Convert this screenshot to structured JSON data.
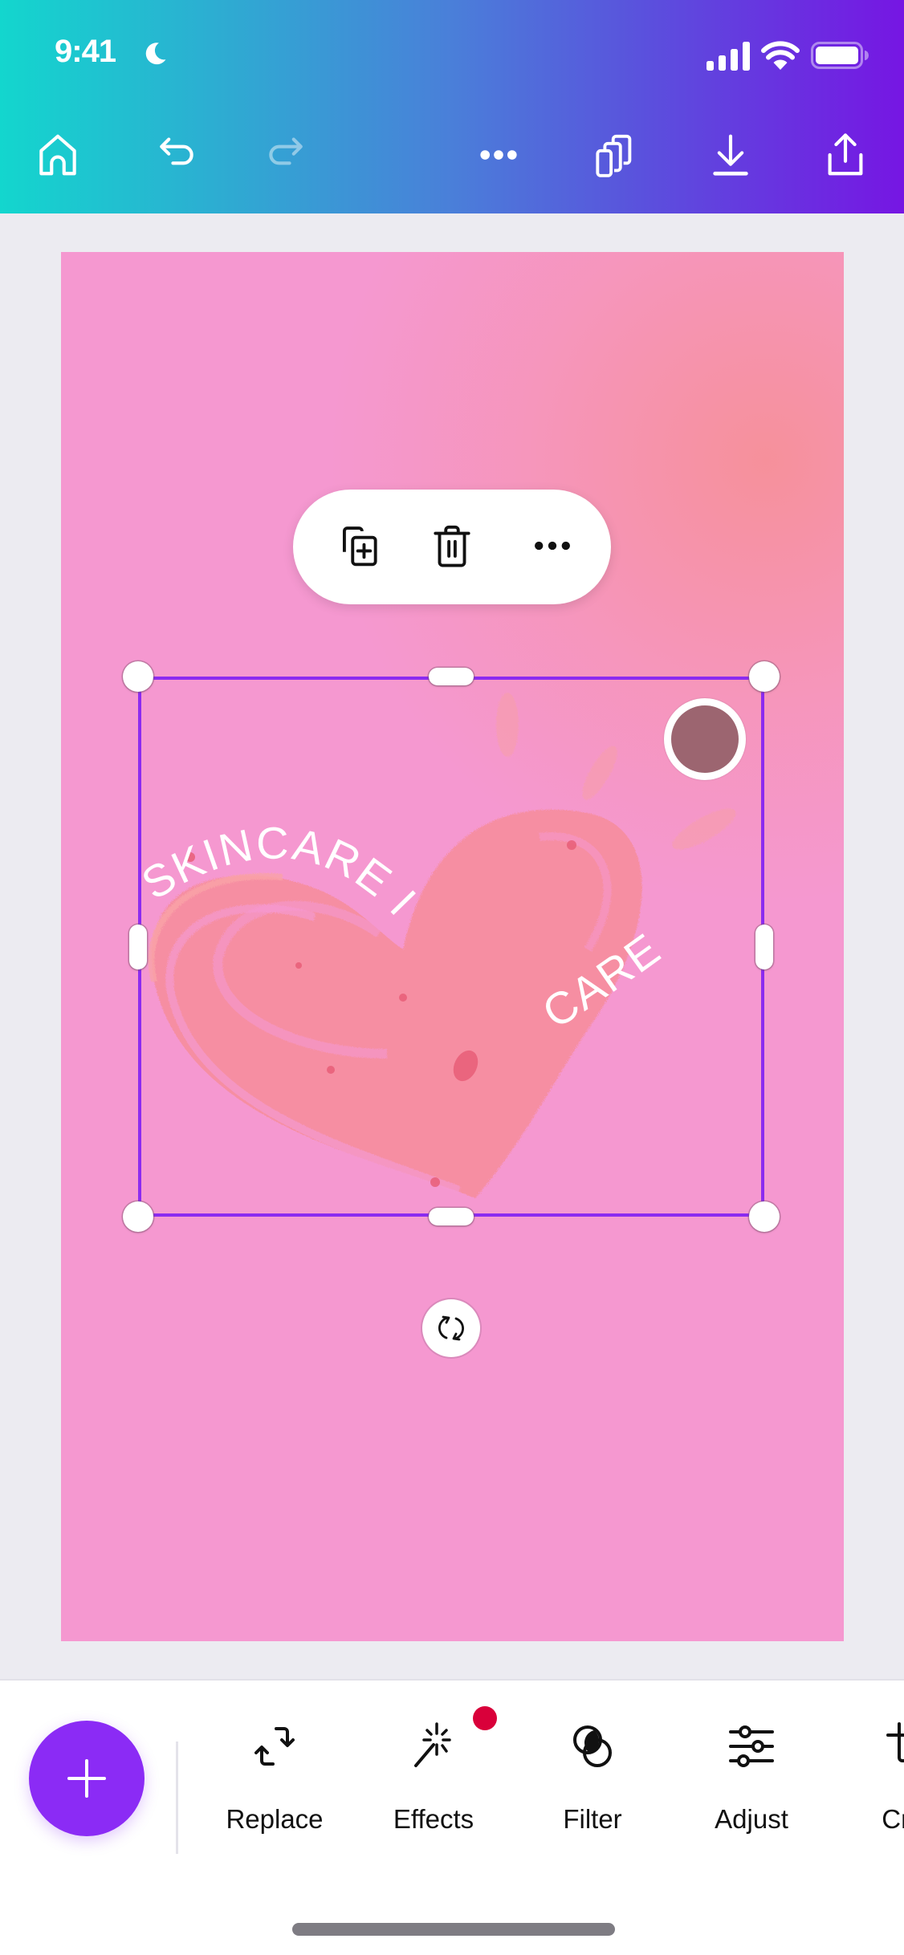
{
  "status_bar": {
    "time": "9:41",
    "focus_icon": "moon-icon",
    "signal_icon": "cellular-signal-icon",
    "wifi_icon": "wifi-icon",
    "battery_icon": "battery-icon"
  },
  "header": {
    "buttons": [
      {
        "name": "home",
        "icon": "home-icon",
        "enabled": true
      },
      {
        "name": "undo",
        "icon": "undo-icon",
        "enabled": true
      },
      {
        "name": "redo",
        "icon": "redo-icon",
        "enabled": false
      },
      {
        "name": "more",
        "icon": "more-horizontal-icon",
        "enabled": true
      },
      {
        "name": "pages",
        "icon": "pages-icon",
        "enabled": true
      },
      {
        "name": "download",
        "icon": "download-icon",
        "enabled": true
      },
      {
        "name": "share",
        "icon": "share-icon",
        "enabled": true
      }
    ],
    "gradient_start": "#13D6CE",
    "gradient_end": "#7616E3"
  },
  "context_toolbar": {
    "buttons": [
      {
        "name": "duplicate",
        "icon": "duplicate-icon"
      },
      {
        "name": "delete",
        "icon": "trash-icon"
      },
      {
        "name": "more",
        "icon": "more-horizontal-icon"
      }
    ]
  },
  "design": {
    "background_color": "#F598D0",
    "accent_tint": "#F6909A",
    "image_text": {
      "arc_text": "SKINCARE IS",
      "right_text": "CARE"
    },
    "color_swatch": "#9C6570",
    "selection_color": "#8B2BF0"
  },
  "bottom_toolbar": {
    "add_button_icon": "plus-icon",
    "add_button_color": "#8B2BF5",
    "tools": [
      {
        "label": "Replace",
        "icon": "replace-icon",
        "badge": false
      },
      {
        "label": "Effects",
        "icon": "magic-wand-icon",
        "badge": true
      },
      {
        "label": "Filter",
        "icon": "filter-icon",
        "badge": false
      },
      {
        "label": "Adjust",
        "icon": "sliders-icon",
        "badge": false
      },
      {
        "label": "Crop",
        "icon": "crop-icon",
        "badge": false
      }
    ],
    "badge_color": "#D9003A"
  }
}
